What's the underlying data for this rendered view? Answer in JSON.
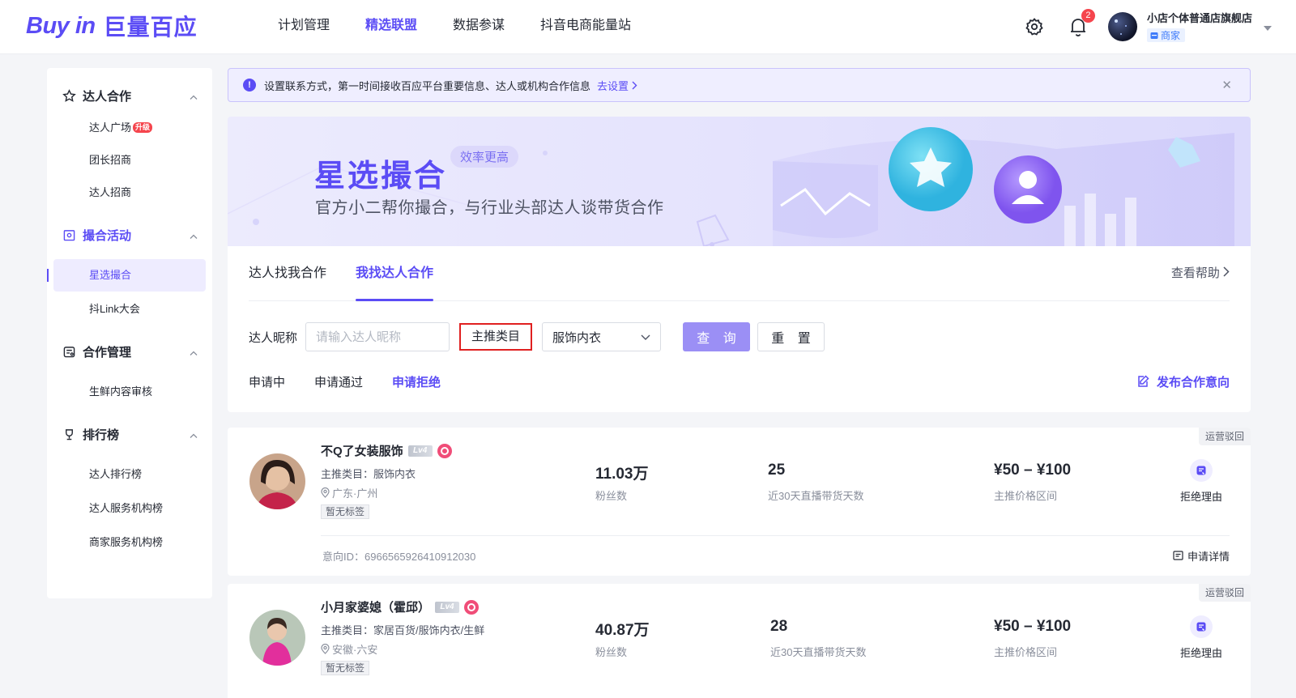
{
  "header": {
    "logo_en": "Buy in",
    "logo_cn": "巨量百应",
    "nav": [
      "计划管理",
      "精选联盟",
      "数据参谋",
      "抖音电商能量站"
    ],
    "nav_active": 1,
    "bell_count": "2",
    "shop_name": "小店个体普通店旗舰店",
    "shop_role": "商家"
  },
  "sidebar": {
    "groups": [
      {
        "label": "达人合作",
        "icon": "star-icon",
        "items": [
          {
            "label": "达人广场",
            "badge": "升级"
          },
          {
            "label": "团长招商"
          },
          {
            "label": "达人招商"
          }
        ]
      },
      {
        "label": "撮合活动",
        "icon": "calendar-icon",
        "items": [
          {
            "label": "星选撮合"
          },
          {
            "label": "抖Link大会"
          }
        ]
      },
      {
        "label": "合作管理",
        "icon": "handshake-icon",
        "items": [
          {
            "label": "生鲜内容审核"
          }
        ]
      },
      {
        "label": "排行榜",
        "icon": "trophy-icon",
        "items": [
          {
            "label": "达人排行榜"
          },
          {
            "label": "达人服务机构榜"
          },
          {
            "label": "商家服务机构榜"
          }
        ]
      }
    ]
  },
  "notice": {
    "text": "设置联系方式，第一时间接收百应平台重要信息、达人或机构合作信息",
    "link": "去设置"
  },
  "banner": {
    "title": "星选撮合",
    "tag": "效率更高",
    "subtitle": "官方小二帮你撮合，与行业头部达人谈带货合作"
  },
  "main": {
    "tabs": [
      "达人找我合作",
      "我找达人合作"
    ],
    "help": "查看帮助",
    "filter": {
      "nick_label": "达人昵称",
      "nick_placeholder": "请输入达人昵称",
      "category_label": "主推类目",
      "category_value": "服饰内衣",
      "query": "查 询",
      "reset": "重 置"
    },
    "subtabs": [
      "申请中",
      "申请通过",
      "申请拒绝"
    ],
    "publish": "发布合作意向"
  },
  "list": [
    {
      "status": "运营驳回",
      "name": "不Q了女装服饰",
      "level": "Lv4",
      "category": "主推类目：服饰内衣",
      "location": "广东·广州",
      "tag": "暂无标签",
      "fans": "11.03万",
      "fans_label": "粉丝数",
      "days": "25",
      "days_label": "近30天直播带货天数",
      "price": "¥50 – ¥100",
      "price_label": "主推价格区间",
      "reason": "拒绝理由",
      "intent_id": "意向ID：6966565926410912030",
      "detail": "申请详情"
    },
    {
      "status": "运营驳回",
      "name": "小月家婆媳（霍邱）",
      "level": "Lv4",
      "category": "主推类目：家居百货/服饰内衣/生鲜",
      "location": "安徽·六安",
      "tag": "暂无标签",
      "fans": "40.87万",
      "fans_label": "粉丝数",
      "days": "28",
      "days_label": "近30天直播带货天数",
      "price": "¥50 – ¥100",
      "price_label": "主推价格区间",
      "reason": "拒绝理由"
    }
  ]
}
